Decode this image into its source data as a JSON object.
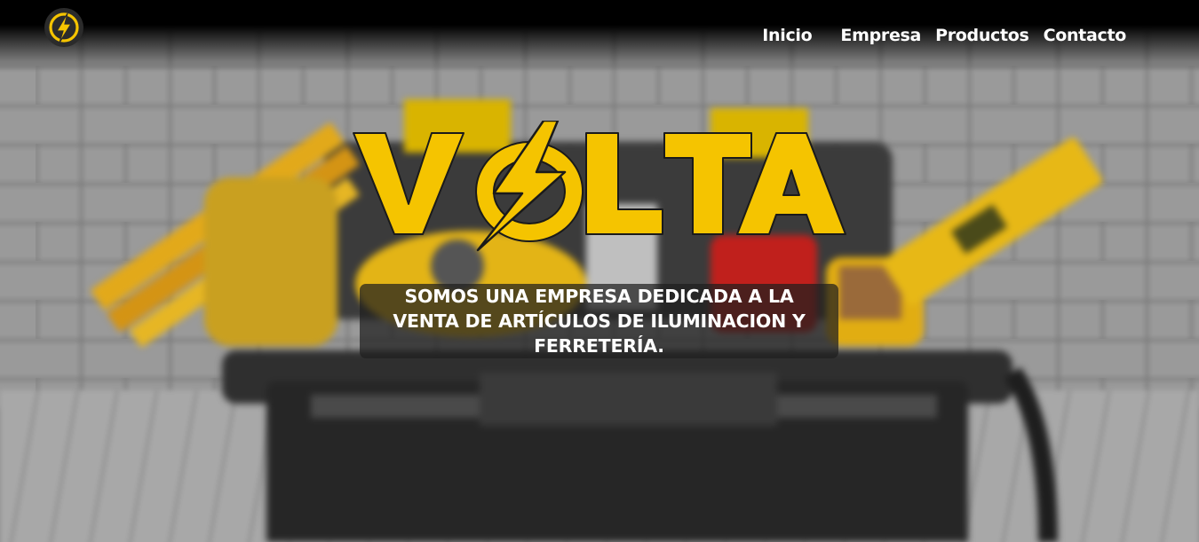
{
  "header": {
    "logo_icon": "lightning-bolt-icon",
    "nav": [
      {
        "label": "Inicio"
      },
      {
        "label": "Empresa"
      },
      {
        "label": "Productos"
      },
      {
        "label": "Contacto"
      }
    ]
  },
  "hero": {
    "brand": "VOLTA",
    "tagline": "SOMOS UNA EMPRESA DEDICADA A LA VENTA DE ARTÍCULOS DE ILUMINACION Y FERRETERÍA."
  },
  "colors": {
    "accent": "#F5C400",
    "bolt": "#FFCC00",
    "header": "#000000",
    "text": "#FFFFFF"
  }
}
